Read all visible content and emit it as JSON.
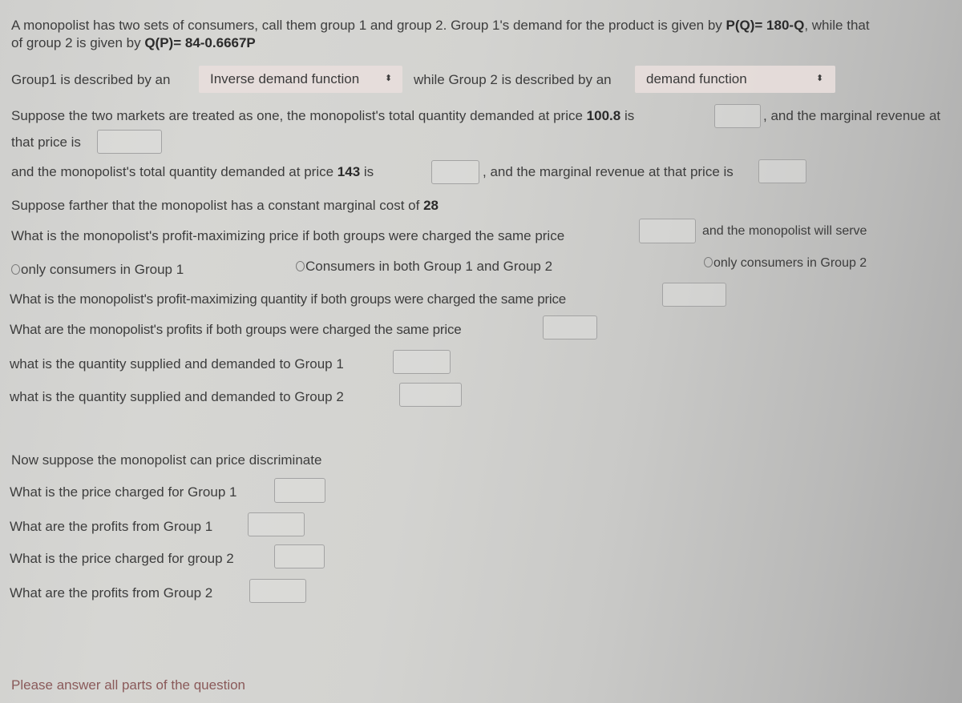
{
  "intro": {
    "line1_text": "A monopolist has two sets of consumers, call them group 1 and group 2. Group 1's demand for the product is given by ",
    "group1_eq": "P(Q)= 180-Q",
    "line1_tail": ", while that",
    "line2_text": "of group 2 is given by ",
    "group2_eq": "Q(P)= 84-0.6667P"
  },
  "describe": {
    "label1": "Group1 is described by an",
    "select1_value": "Inverse demand function",
    "label2": "while Group 2 is described by an",
    "select2_value": "demand function"
  },
  "combined": {
    "q1_pre": "Suppose the two markets are treated as one, the monopolist's total quantity demanded at price ",
    "price1": "100.8",
    "q1_is": " is",
    "q1_mid": ", and the marginal revenue at",
    "q1_line2": "that price is",
    "q2_pre": "and the monopolist's total quantity demanded at price ",
    "price2": "143",
    "q2_is": " is",
    "q2_mid": ", and the marginal revenue at that price is"
  },
  "single_price": {
    "mc_text": "Suppose farther that the monopolist has a constant marginal cost of ",
    "mc_value": "28",
    "price_question": "What is the monopolist's profit-maximizing price if both groups were charged the same price",
    "serve_text": "and the monopolist will serve",
    "radio_options": [
      "only consumers in Group 1",
      "Consumers in both Group 1 and Group 2",
      "only consumers in Group 2"
    ],
    "quantity_question": "What is the monopolist's profit-maximizing quantity if both groups were charged the same price",
    "profit_question": "What are the monopolist's profits if both groups were charged the same price",
    "group1_qty_question": "what is the quantity supplied and demanded to Group 1",
    "group2_qty_question": "what is the quantity supplied and demanded to Group 2"
  },
  "discrimination": {
    "heading": "Now suppose the monopolist can price discriminate",
    "price_g1": "What is the price charged for Group 1",
    "profit_g1": "What are the profits from Group 1",
    "price_g2": "What is the price charged for group 2",
    "profit_g2": "What are the profits from Group 2"
  },
  "footer": {
    "warning": "Please answer all parts of the question"
  },
  "icons": {
    "select_arrows": "⬍"
  }
}
